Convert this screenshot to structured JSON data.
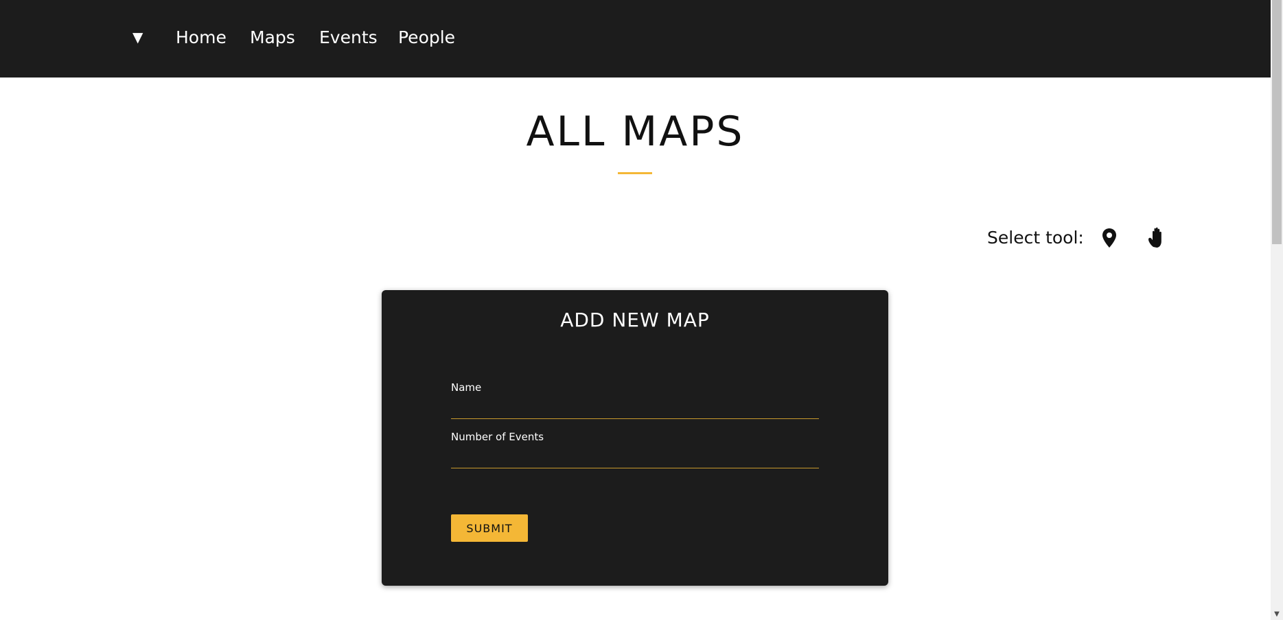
{
  "nav": {
    "toggle_symbol": "▼",
    "links": [
      "Home",
      "Maps",
      "Events",
      "People"
    ]
  },
  "page": {
    "title": "ALL MAPS"
  },
  "tools": {
    "label": "Select tool:",
    "items": [
      {
        "name": "pin",
        "icon": "map-pin-icon"
      },
      {
        "name": "hand",
        "icon": "hand-icon"
      }
    ]
  },
  "form": {
    "title": "ADD NEW MAP",
    "fields": [
      {
        "label": "Name",
        "value": ""
      },
      {
        "label": "Number of Events",
        "value": ""
      }
    ],
    "submit_label": "SUBMIT"
  },
  "colors": {
    "nav_bg": "#1c1c1c",
    "accent": "#f4b736",
    "card_bg": "#1c1c1c"
  }
}
